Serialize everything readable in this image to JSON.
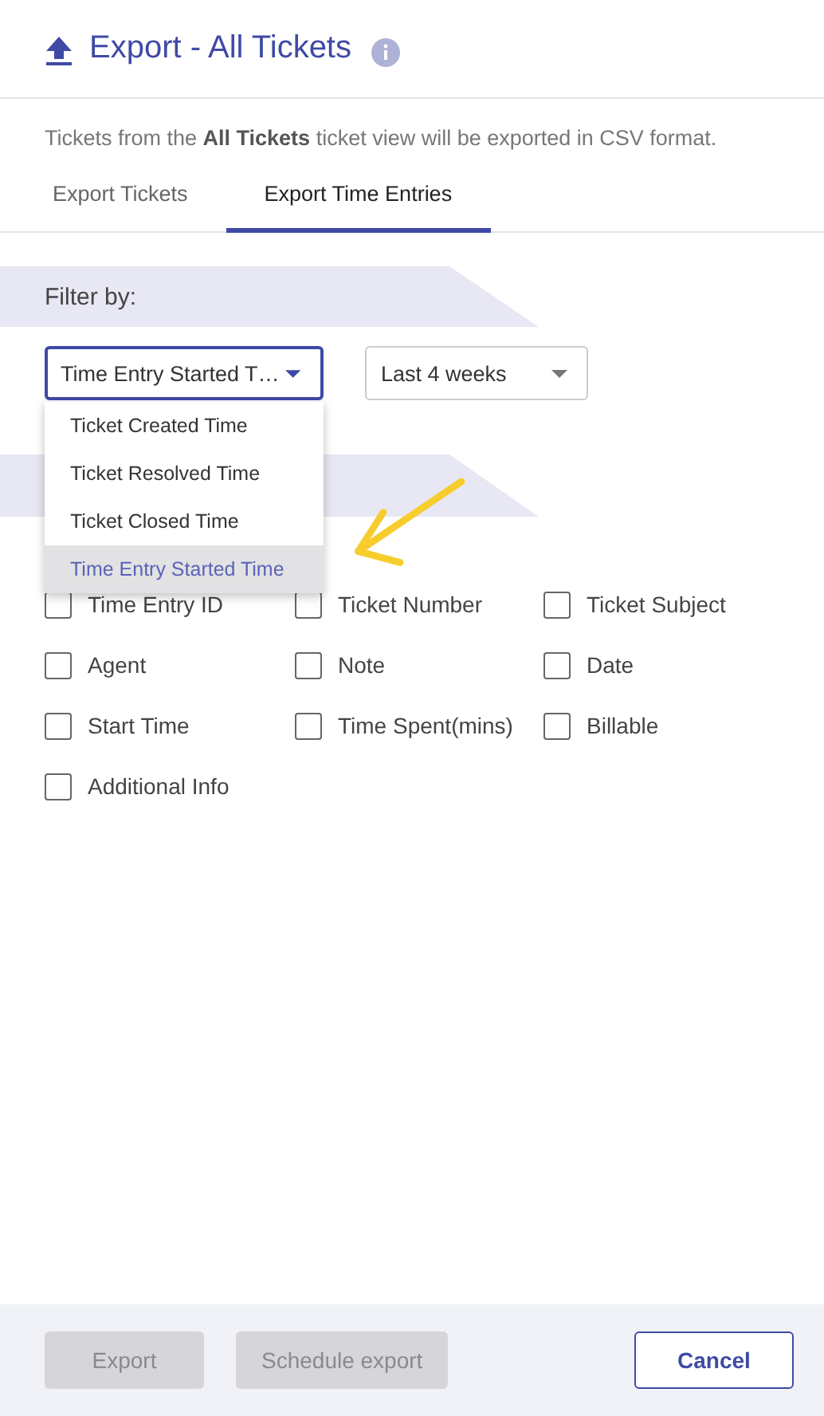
{
  "header": {
    "title": "Export - All Tickets"
  },
  "description": "Tickets from the **All Tickets** ticket view will be exported in CSV format.",
  "tabs": [
    {
      "label": "Export Tickets",
      "selected": false
    },
    {
      "label": "Export Time Entries",
      "selected": true
    }
  ],
  "filter": {
    "heading": "Filter by:",
    "field_select": {
      "value": "Time Entry Started T…",
      "expanded": true
    },
    "period_select": {
      "value": "Last 4 weeks"
    },
    "options": [
      {
        "label": "Ticket Created Time",
        "selected": false
      },
      {
        "label": "Ticket Resolved Time",
        "selected": false
      },
      {
        "label": "Ticket Closed Time",
        "selected": false
      },
      {
        "label": "Time Entry Started Time",
        "selected": true
      }
    ]
  },
  "fields": [
    {
      "label": "Time Entry ID",
      "checked": false
    },
    {
      "label": "Ticket Number",
      "checked": false
    },
    {
      "label": "Ticket Subject",
      "checked": false
    },
    {
      "label": "Agent",
      "checked": false
    },
    {
      "label": "Note",
      "checked": false
    },
    {
      "label": "Date",
      "checked": false
    },
    {
      "label": "Start Time",
      "checked": false
    },
    {
      "label": "Time Spent(mins)",
      "checked": false
    },
    {
      "label": "Billable",
      "checked": false
    },
    {
      "label": "Additional Info",
      "checked": false
    }
  ],
  "buttons": [
    {
      "label": "Export",
      "disabled": true
    },
    {
      "label": "Schedule export",
      "disabled": true
    },
    {
      "label": "Cancel",
      "disabled": false
    }
  ]
}
